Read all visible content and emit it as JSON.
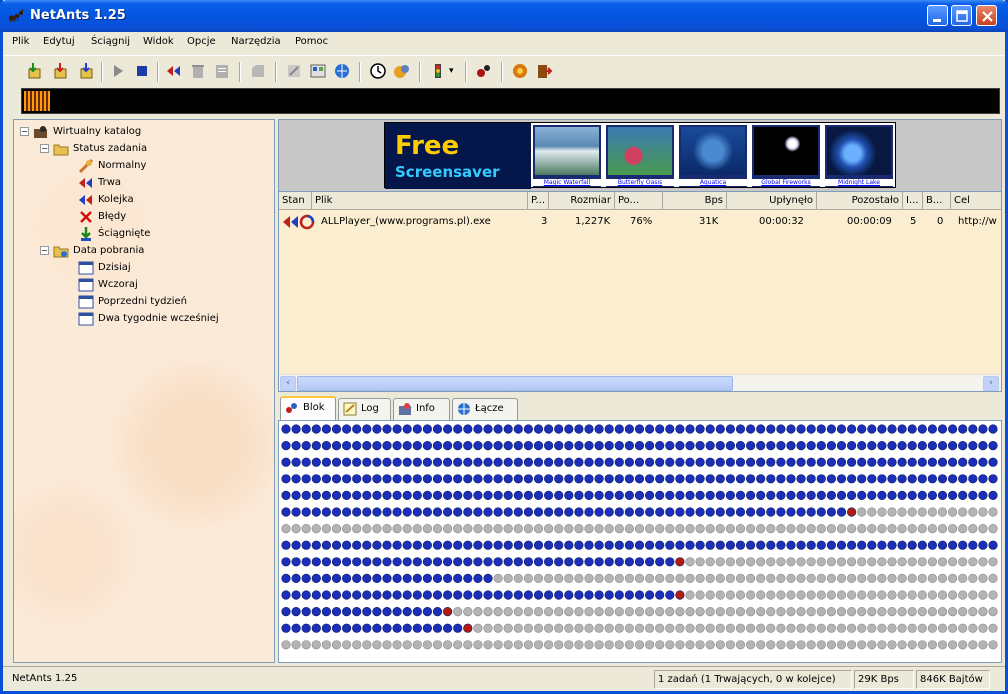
{
  "window": {
    "title": "NetAnts 1.25"
  },
  "menu": [
    "Plik",
    "Edytuj",
    "Ściągnij",
    "Widok",
    "Opcje",
    "Narzędzia",
    "Pomoc"
  ],
  "tree": {
    "root": "Wirtualny katalog",
    "status_group": "Status zadania",
    "status_items": [
      "Normalny",
      "Trwa",
      "Kolejka",
      "Błędy",
      "Ściągnięte"
    ],
    "date_group": "Data pobrania",
    "date_items": [
      "Dzisiaj",
      "Wczoraj",
      "Poprzedni tydzień",
      "Dwa tygodnie wcześniej"
    ]
  },
  "banner": {
    "headline": "Free",
    "subline": "Screensaver",
    "thumbs": [
      "Magic Waterfall",
      "Butterfly Oasis",
      "Aquatica",
      "Global Fireworks",
      "Midnight Lake"
    ]
  },
  "list": {
    "columns": [
      "Stan",
      "Plik",
      "P...",
      "Rozmiar",
      "Po...",
      "Bps",
      "Upłynęło",
      "Pozostało",
      "I...",
      "B...",
      "Cel"
    ],
    "rows": [
      {
        "file": "ALLPlayer_(www.programs.pl).exe",
        "parts": "3",
        "size": "1,227K",
        "progress": "76%",
        "bps": "31K",
        "elapsed": "00:00:32",
        "remaining": "00:00:09",
        "i": "5",
        "b": "0",
        "target": "http://w"
      }
    ]
  },
  "tabs": [
    "Blok",
    "Log",
    "Info",
    "Łącze"
  ],
  "status": {
    "left": "NetAnts 1.25",
    "tasks": "1 zadań (1 Trwających, 0 w kolejce)",
    "speed": "29K Bps",
    "bytes": "846K Bajtów"
  },
  "colors": {
    "done_block": "#1c2fb8",
    "pending_block": "#b4b4b4",
    "active_block": "#b31b10",
    "title_bar": "#0a4fd6"
  }
}
